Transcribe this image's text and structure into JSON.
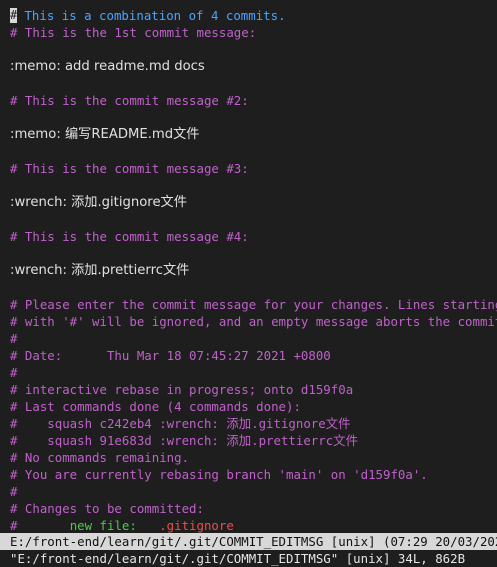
{
  "editor": {
    "cursor_char": "#",
    "lines": {
      "l1": " This is a combination of 4 commits.",
      "l2": "# This is the 1st commit message:",
      "l3": ":memo: add readme.md docs",
      "l4": "# This is the commit message #2:",
      "l5": ":memo: 编写README.md文件",
      "l6": "# This is the commit message #3:",
      "l7": ":wrench: 添加.gitignore文件",
      "l8": "# This is the commit message #4:",
      "l9": ":wrench: 添加.prettierrc文件",
      "l10": "# Please enter the commit message for your changes. Lines starting",
      "l11": "# with '#' will be ignored, and an empty message aborts the commit.",
      "l12": "#",
      "l13": "# Date:      Thu Mar 18 07:45:27 2021 +0800",
      "l14": "#",
      "l15": "# interactive rebase in progress; onto d159f0a",
      "l16": "# Last commands done (4 commands done):",
      "l17": "#    squash c242eb4 :wrench: 添加.gitignore文件",
      "l18": "#    squash 91e683d :wrench: 添加.prettierrc文件",
      "l19": "# No commands remaining.",
      "l20": "# You are currently rebasing branch 'main' on 'd159f0a'.",
      "l21": "#",
      "l22": "# Changes to be committed:",
      "l23_prefix": "#       ",
      "l23_label": "new file:",
      "l23_gap": "   ",
      "l23_file": ".gitignore"
    }
  },
  "statusbar": {
    "text": "E:/front-end/learn/git/.git/COMMIT_EDITMSG [unix] (07:29 20/03/2021)"
  },
  "cmdline": {
    "text": "\"E:/front-end/learn/git/.git/COMMIT_EDITMSG\" [unix] 34L, 862B"
  },
  "colors": {
    "background": "#1e1e1e",
    "comment": "#c061cb",
    "first_line": "#4aa3ff",
    "plain_text": "#e0e0e0",
    "new_file_label": "#4ec94e",
    "new_file_name": "#f14c4c",
    "statusbar_bg": "#d8d8d8"
  }
}
